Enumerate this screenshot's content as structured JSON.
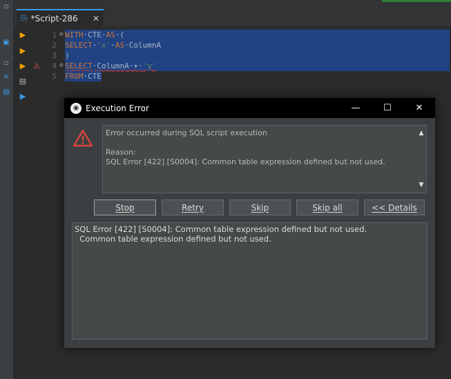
{
  "editor_tab": {
    "label": "*Script-286",
    "icon": "sql-script-icon"
  },
  "code_lines": [
    {
      "num": "1",
      "tokens": [
        [
          "kw",
          "WITH"
        ],
        [
          "code",
          "·"
        ],
        [
          "code",
          "CTE"
        ],
        [
          "code",
          "·"
        ],
        [
          "kw",
          "AS"
        ],
        [
          "code",
          "·("
        ]
      ]
    },
    {
      "num": "2",
      "tokens": [
        [
          "kw",
          "SELECT"
        ],
        [
          "code",
          "·"
        ],
        [
          "str",
          "'x'"
        ],
        [
          "code",
          "·"
        ],
        [
          "kw",
          "AS"
        ],
        [
          "code",
          "·ColumnA"
        ]
      ]
    },
    {
      "num": "3",
      "tokens": [
        [
          "code",
          ")"
        ]
      ]
    },
    {
      "num": "4",
      "tokens": [
        [
          "kw",
          "SELECT"
        ],
        [
          "code",
          "·ColumnA·+·"
        ],
        [
          "str",
          "'y'"
        ]
      ]
    },
    {
      "num": "5",
      "tokens": [
        [
          "kw",
          "FROM"
        ],
        [
          "code",
          "·CTE"
        ]
      ]
    }
  ],
  "dialog": {
    "title": "Execution Error",
    "message_lines": [
      "Error occurred during SQL script execution",
      "",
      "Reason:",
      "SQL Error [422] [S0004]: Common table expression defined but not used."
    ],
    "buttons": [
      "Stop",
      "Retry",
      "Skip",
      "Skip all",
      "<< Details"
    ],
    "details_lines": [
      "SQL Error [422] [S0004]: Common table expression defined but not used.",
      "  Common table expression defined but not used."
    ]
  }
}
